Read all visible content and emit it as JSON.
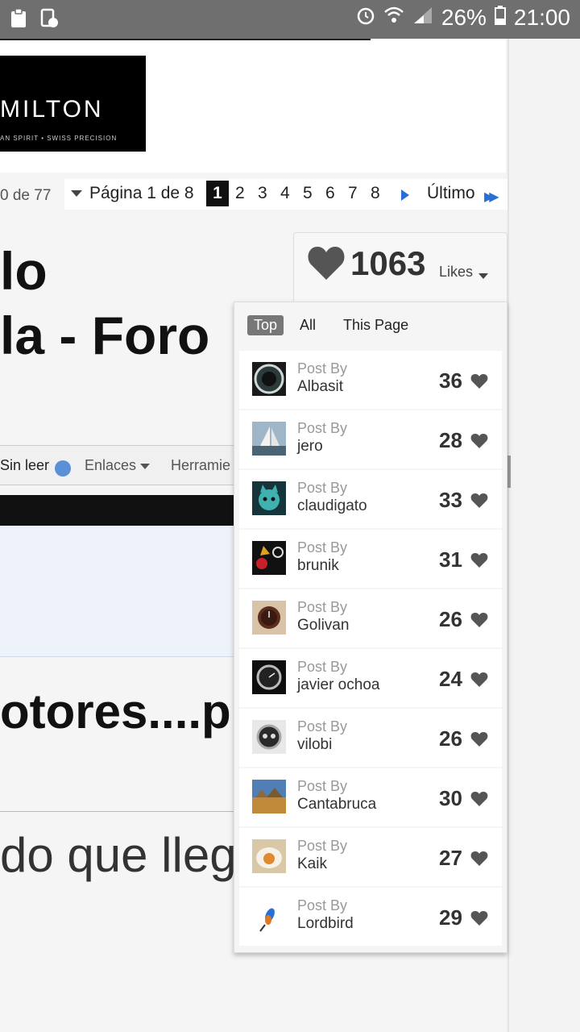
{
  "status_bar": {
    "battery": "26%",
    "time": "21:00"
  },
  "banner": {
    "logo_text": "MILTON",
    "logo_subtext": "AN SPIRIT • SWISS PRECISION"
  },
  "pagination": {
    "count_text": "0 de 77",
    "page_label": "Página 1 de 8",
    "pages": [
      "1",
      "2",
      "3",
      "4",
      "5",
      "6",
      "7",
      "8"
    ],
    "current": "1",
    "last_label": "Último"
  },
  "thread": {
    "title_line1": "lo",
    "title_line2": "la - Foro",
    "subtitle": "otores....p",
    "body_text": "do que lleg"
  },
  "menu": {
    "unread": "Sin leer",
    "links": "Enlaces",
    "tools": "Herramie"
  },
  "likes": {
    "total": "1063",
    "label": "Likes",
    "tabs": [
      "Top",
      "All",
      "This Page"
    ],
    "active_tab": "Top",
    "post_by_label": "Post By",
    "rows": [
      {
        "user": "Albasit",
        "count": "36"
      },
      {
        "user": "jero",
        "count": "28"
      },
      {
        "user": "claudigato",
        "count": "33"
      },
      {
        "user": "brunik",
        "count": "31"
      },
      {
        "user": "Golivan",
        "count": "26"
      },
      {
        "user": "javier ochoa",
        "count": "24"
      },
      {
        "user": "vilobi",
        "count": "26"
      },
      {
        "user": "Cantabruca",
        "count": "30"
      },
      {
        "user": "Kaik",
        "count": "27"
      },
      {
        "user": "Lordbird",
        "count": "29"
      }
    ]
  },
  "colors": {
    "status_bar": "#6f6f6f",
    "accent_blue": "#2a6fd6",
    "active_tab": "#777777",
    "heart": "#555555"
  }
}
